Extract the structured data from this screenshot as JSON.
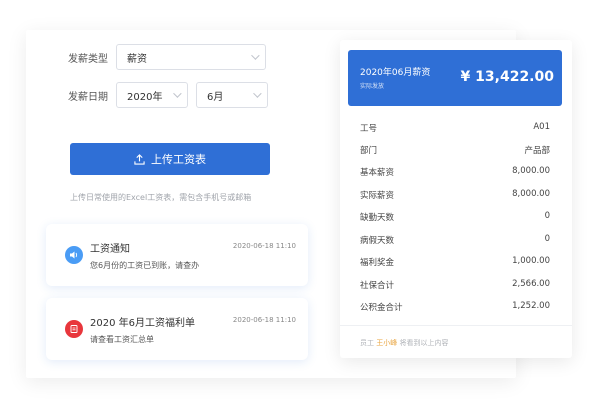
{
  "form": {
    "pay_type_label": "发薪类型",
    "pay_type_value": "薪资",
    "pay_date_label": "发薪日期",
    "year_value": "2020年",
    "month_value": "6月",
    "upload_button": "上传工资表",
    "upload_hint": "上传日常使用的Excel工资表，需包含手机号或邮箱"
  },
  "notifications": [
    {
      "title": "工资通知",
      "time": "2020-06-18 11:10",
      "desc": "您6月份的工资已到账，请查办",
      "icon": "speaker-icon",
      "color": "#4a9cf5"
    },
    {
      "title": "2020 年6月工资福利单",
      "time": "2020-06-18 11:10",
      "desc": "请查看工资汇总单",
      "icon": "document-icon",
      "color": "#e8363c"
    }
  ],
  "salary": {
    "title": "2020年06月薪资",
    "subtitle": "实际发放",
    "amount": "¥ 13,422.00",
    "rows": [
      {
        "label": "工号",
        "value": "A01"
      },
      {
        "label": "部门",
        "value": "产品部"
      },
      {
        "label": "基本薪资",
        "value": "8,000.00"
      },
      {
        "label": "实际薪资",
        "value": "8,000.00"
      },
      {
        "label": "缺勤天数",
        "value": "0"
      },
      {
        "label": "病假天数",
        "value": "0"
      },
      {
        "label": "福利奖金",
        "value": "1,000.00"
      },
      {
        "label": "社保合计",
        "value": "2,566.00"
      },
      {
        "label": "公积金合计",
        "value": "1,252.00"
      }
    ],
    "footer_prefix": "员工",
    "footer_name": "王小峰",
    "footer_suffix": "将看到以上内容"
  },
  "colors": {
    "primary": "#2f6fd6",
    "accent_name": "#e8a33d"
  }
}
